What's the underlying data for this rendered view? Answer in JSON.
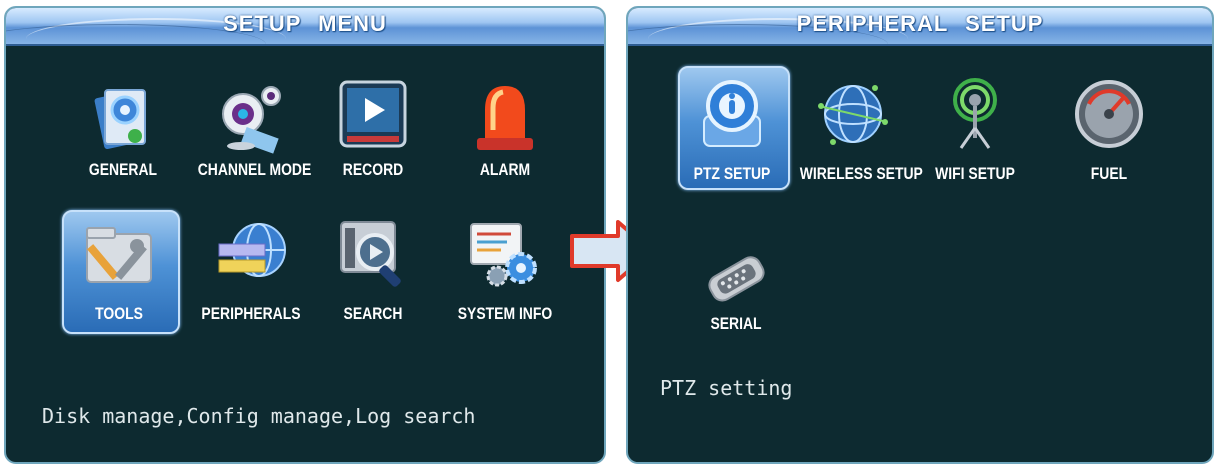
{
  "left_panel": {
    "title": "SETUP  MENU",
    "items": [
      {
        "label": "GENERAL",
        "icon": "general-settings-icon"
      },
      {
        "label": "CHANNEL MODE",
        "icon": "webcam-icon"
      },
      {
        "label": "RECORD",
        "icon": "record-play-icon"
      },
      {
        "label": "ALARM",
        "icon": "alarm-siren-icon"
      },
      {
        "label": "TOOLS",
        "icon": "tools-icon",
        "selected": true
      },
      {
        "label": "PERIPHERALS",
        "icon": "globe-peripherals-icon"
      },
      {
        "label": "SEARCH",
        "icon": "search-icon"
      },
      {
        "label": "SYSTEM INFO",
        "icon": "system-info-gears-icon"
      }
    ],
    "hint": "Disk manage,Config manage,Log search"
  },
  "right_panel": {
    "title": "PERIPHERAL  SETUP",
    "items": [
      {
        "label": "PTZ SETUP",
        "icon": "ptz-camera-icon",
        "selected": true
      },
      {
        "label": "WIRELESS SETUP",
        "icon": "wireless-globe-icon"
      },
      {
        "label": "WIFI SETUP",
        "icon": "wifi-antenna-icon"
      },
      {
        "label": "FUEL",
        "icon": "fuel-gauge-icon"
      },
      {
        "label": "SERIAL",
        "icon": "serial-port-icon"
      }
    ],
    "hint": "PTZ setting"
  },
  "colors": {
    "panel_bg": "#0d2a30",
    "titlebar": "#5d93d6",
    "selection": "#4e92d6",
    "arrow": "#e03a2a"
  }
}
